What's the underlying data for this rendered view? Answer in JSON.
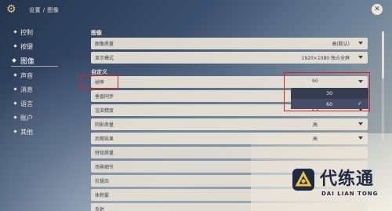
{
  "header": {
    "breadcrumb": "设置 / 图像",
    "close_label": "✕"
  },
  "sidebar": {
    "items": [
      {
        "label": "控制"
      },
      {
        "label": "按键"
      },
      {
        "label": "图像"
      },
      {
        "label": "声音"
      },
      {
        "label": "消息"
      },
      {
        "label": "语言"
      },
      {
        "label": "账户"
      },
      {
        "label": "其他"
      }
    ],
    "active": "图像"
  },
  "sections": {
    "image": "图像",
    "custom": "自定义"
  },
  "rows": [
    {
      "label": "图像质量",
      "value": "高(默认)"
    },
    {
      "label": "显示模式",
      "value": "1920×1080 独占全屏"
    },
    {
      "label": "帧率",
      "value": "60"
    },
    {
      "label": "垂直同步",
      "value": ""
    },
    {
      "label": "渲染精度",
      "value": "1.1"
    },
    {
      "label": "阴影质量",
      "value": "高"
    },
    {
      "label": "后期效果",
      "value": "高"
    },
    {
      "label": "特效质量",
      "value": ""
    },
    {
      "label": "场景细节",
      "value": ""
    },
    {
      "label": "抗锯齿",
      "value": ""
    },
    {
      "label": "体积雾",
      "value": ""
    },
    {
      "label": "反射",
      "value": ""
    }
  ],
  "dropdown": {
    "options": [
      {
        "label": "30",
        "selected": false
      },
      {
        "label": "60",
        "selected": true
      }
    ],
    "check": "✓"
  },
  "watermark": {
    "title": "代练通",
    "subtitle": "DAI LIAN TONG"
  },
  "colors": {
    "accent": "#e02020",
    "panel": "#ece5d8",
    "text_dark": "#3b4255",
    "dropdown_bg": "#353d52"
  }
}
